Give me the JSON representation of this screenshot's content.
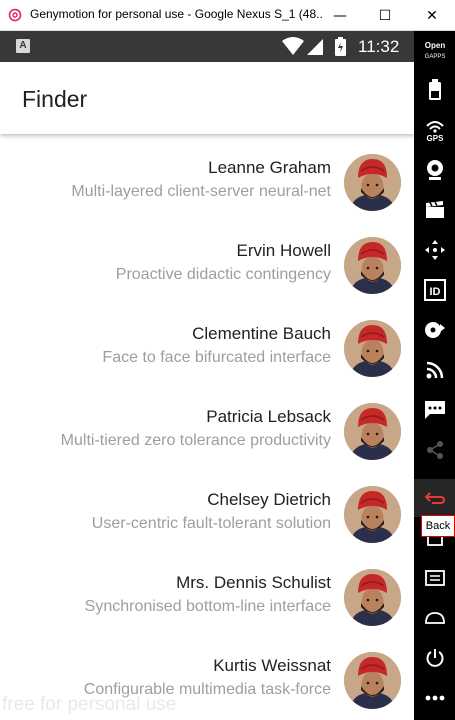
{
  "window": {
    "title": "Genymotion for personal use - Google Nexus S_1 (48...",
    "minimize_glyph": "—",
    "maximize_glyph": "☐",
    "close_glyph": "✕"
  },
  "statusbar": {
    "sim_label": "A",
    "time": "11:32"
  },
  "appbar": {
    "title": "Finder"
  },
  "contacts": [
    {
      "name": "Leanne Graham",
      "description": "Multi-layered client-server neural-net"
    },
    {
      "name": "Ervin Howell",
      "description": "Proactive didactic contingency"
    },
    {
      "name": "Clementine Bauch",
      "description": "Face to face bifurcated interface"
    },
    {
      "name": "Patricia Lebsack",
      "description": "Multi-tiered zero tolerance productivity"
    },
    {
      "name": "Chelsey Dietrich",
      "description": "User-centric fault-tolerant solution"
    },
    {
      "name": "Mrs. Dennis Schulist",
      "description": "Synchronised bottom-line interface"
    },
    {
      "name": "Kurtis Weissnat",
      "description": "Configurable multimedia task-force"
    }
  ],
  "sidebar": {
    "opengapps_label": "Open GAPPS",
    "gps_label": "GPS",
    "id_label": "ID",
    "tooltip": "Back"
  },
  "watermark": "free for personal use",
  "colors": {
    "statusbar": "#383838",
    "sidebar": "#000000",
    "back_accent": "#e53935",
    "avatar_turban": "#c62828"
  }
}
